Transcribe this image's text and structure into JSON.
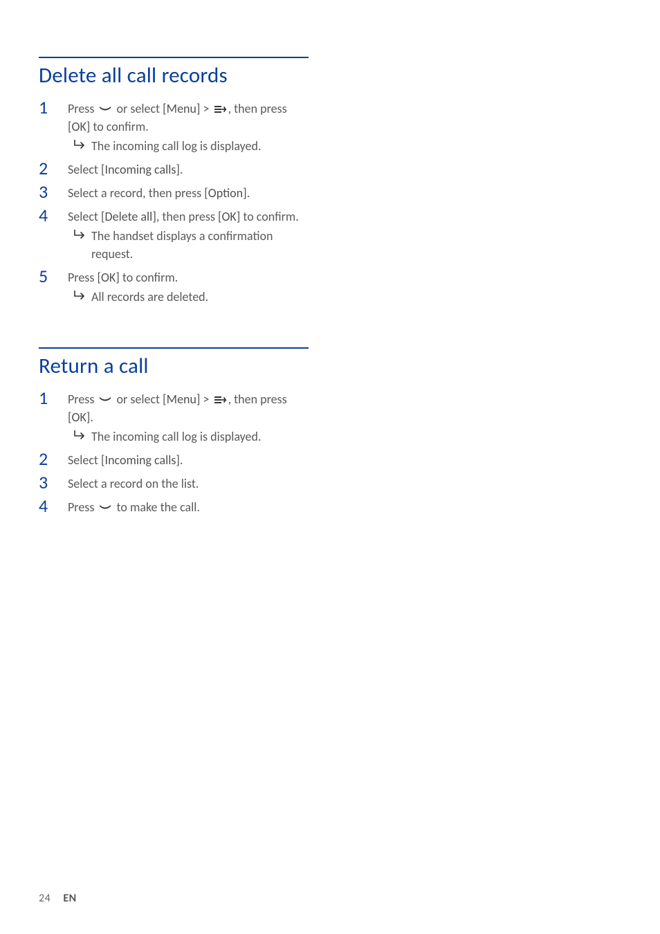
{
  "sections": [
    {
      "heading": "Delete all call records",
      "steps": [
        {
          "num": "1",
          "seg": [
            {
              "t": "Press "
            },
            {
              "icon": "down-key"
            },
            {
              "t": " or select "
            },
            {
              "b": "[Menu]"
            },
            {
              "t": " > "
            },
            {
              "icon": "call-log"
            },
            {
              "t": ", then press "
            },
            {
              "b": "[OK]"
            },
            {
              "t": " to confirm."
            }
          ],
          "sub": "The incoming call log is displayed."
        },
        {
          "num": "2",
          "seg": [
            {
              "t": "Select "
            },
            {
              "b": "[Incoming calls]"
            },
            {
              "t": "."
            }
          ]
        },
        {
          "num": "3",
          "seg": [
            {
              "t": "Select a record, then press "
            },
            {
              "b": "[Option]"
            },
            {
              "t": "."
            }
          ]
        },
        {
          "num": "4",
          "seg": [
            {
              "t": "Select "
            },
            {
              "b": "[Delete all]"
            },
            {
              "t": ", then press "
            },
            {
              "b": "[OK]"
            },
            {
              "t": " to confirm."
            }
          ],
          "sub": "The handset displays a confirmation request."
        },
        {
          "num": "5",
          "seg": [
            {
              "t": "Press "
            },
            {
              "b": "[OK]"
            },
            {
              "t": " to confirm."
            }
          ],
          "sub": "All records are deleted."
        }
      ]
    },
    {
      "heading": "Return a call",
      "steps": [
        {
          "num": "1",
          "seg": [
            {
              "t": "Press "
            },
            {
              "icon": "down-key"
            },
            {
              "t": " or select "
            },
            {
              "b": "[Menu]"
            },
            {
              "t": " > "
            },
            {
              "icon": "call-log"
            },
            {
              "t": ", then press "
            },
            {
              "b": "[OK]"
            },
            {
              "t": "."
            }
          ],
          "sub": "The incoming call log is displayed."
        },
        {
          "num": "2",
          "seg": [
            {
              "t": "Select "
            },
            {
              "b": "[Incoming calls]"
            },
            {
              "t": "."
            }
          ]
        },
        {
          "num": "3",
          "seg": [
            {
              "t": "Select a record on the list."
            }
          ]
        },
        {
          "num": "4",
          "seg": [
            {
              "t": "Press "
            },
            {
              "icon": "call-key"
            },
            {
              "t": " to make the call."
            }
          ]
        }
      ]
    }
  ],
  "footer": {
    "page": "24",
    "lang": "EN"
  }
}
